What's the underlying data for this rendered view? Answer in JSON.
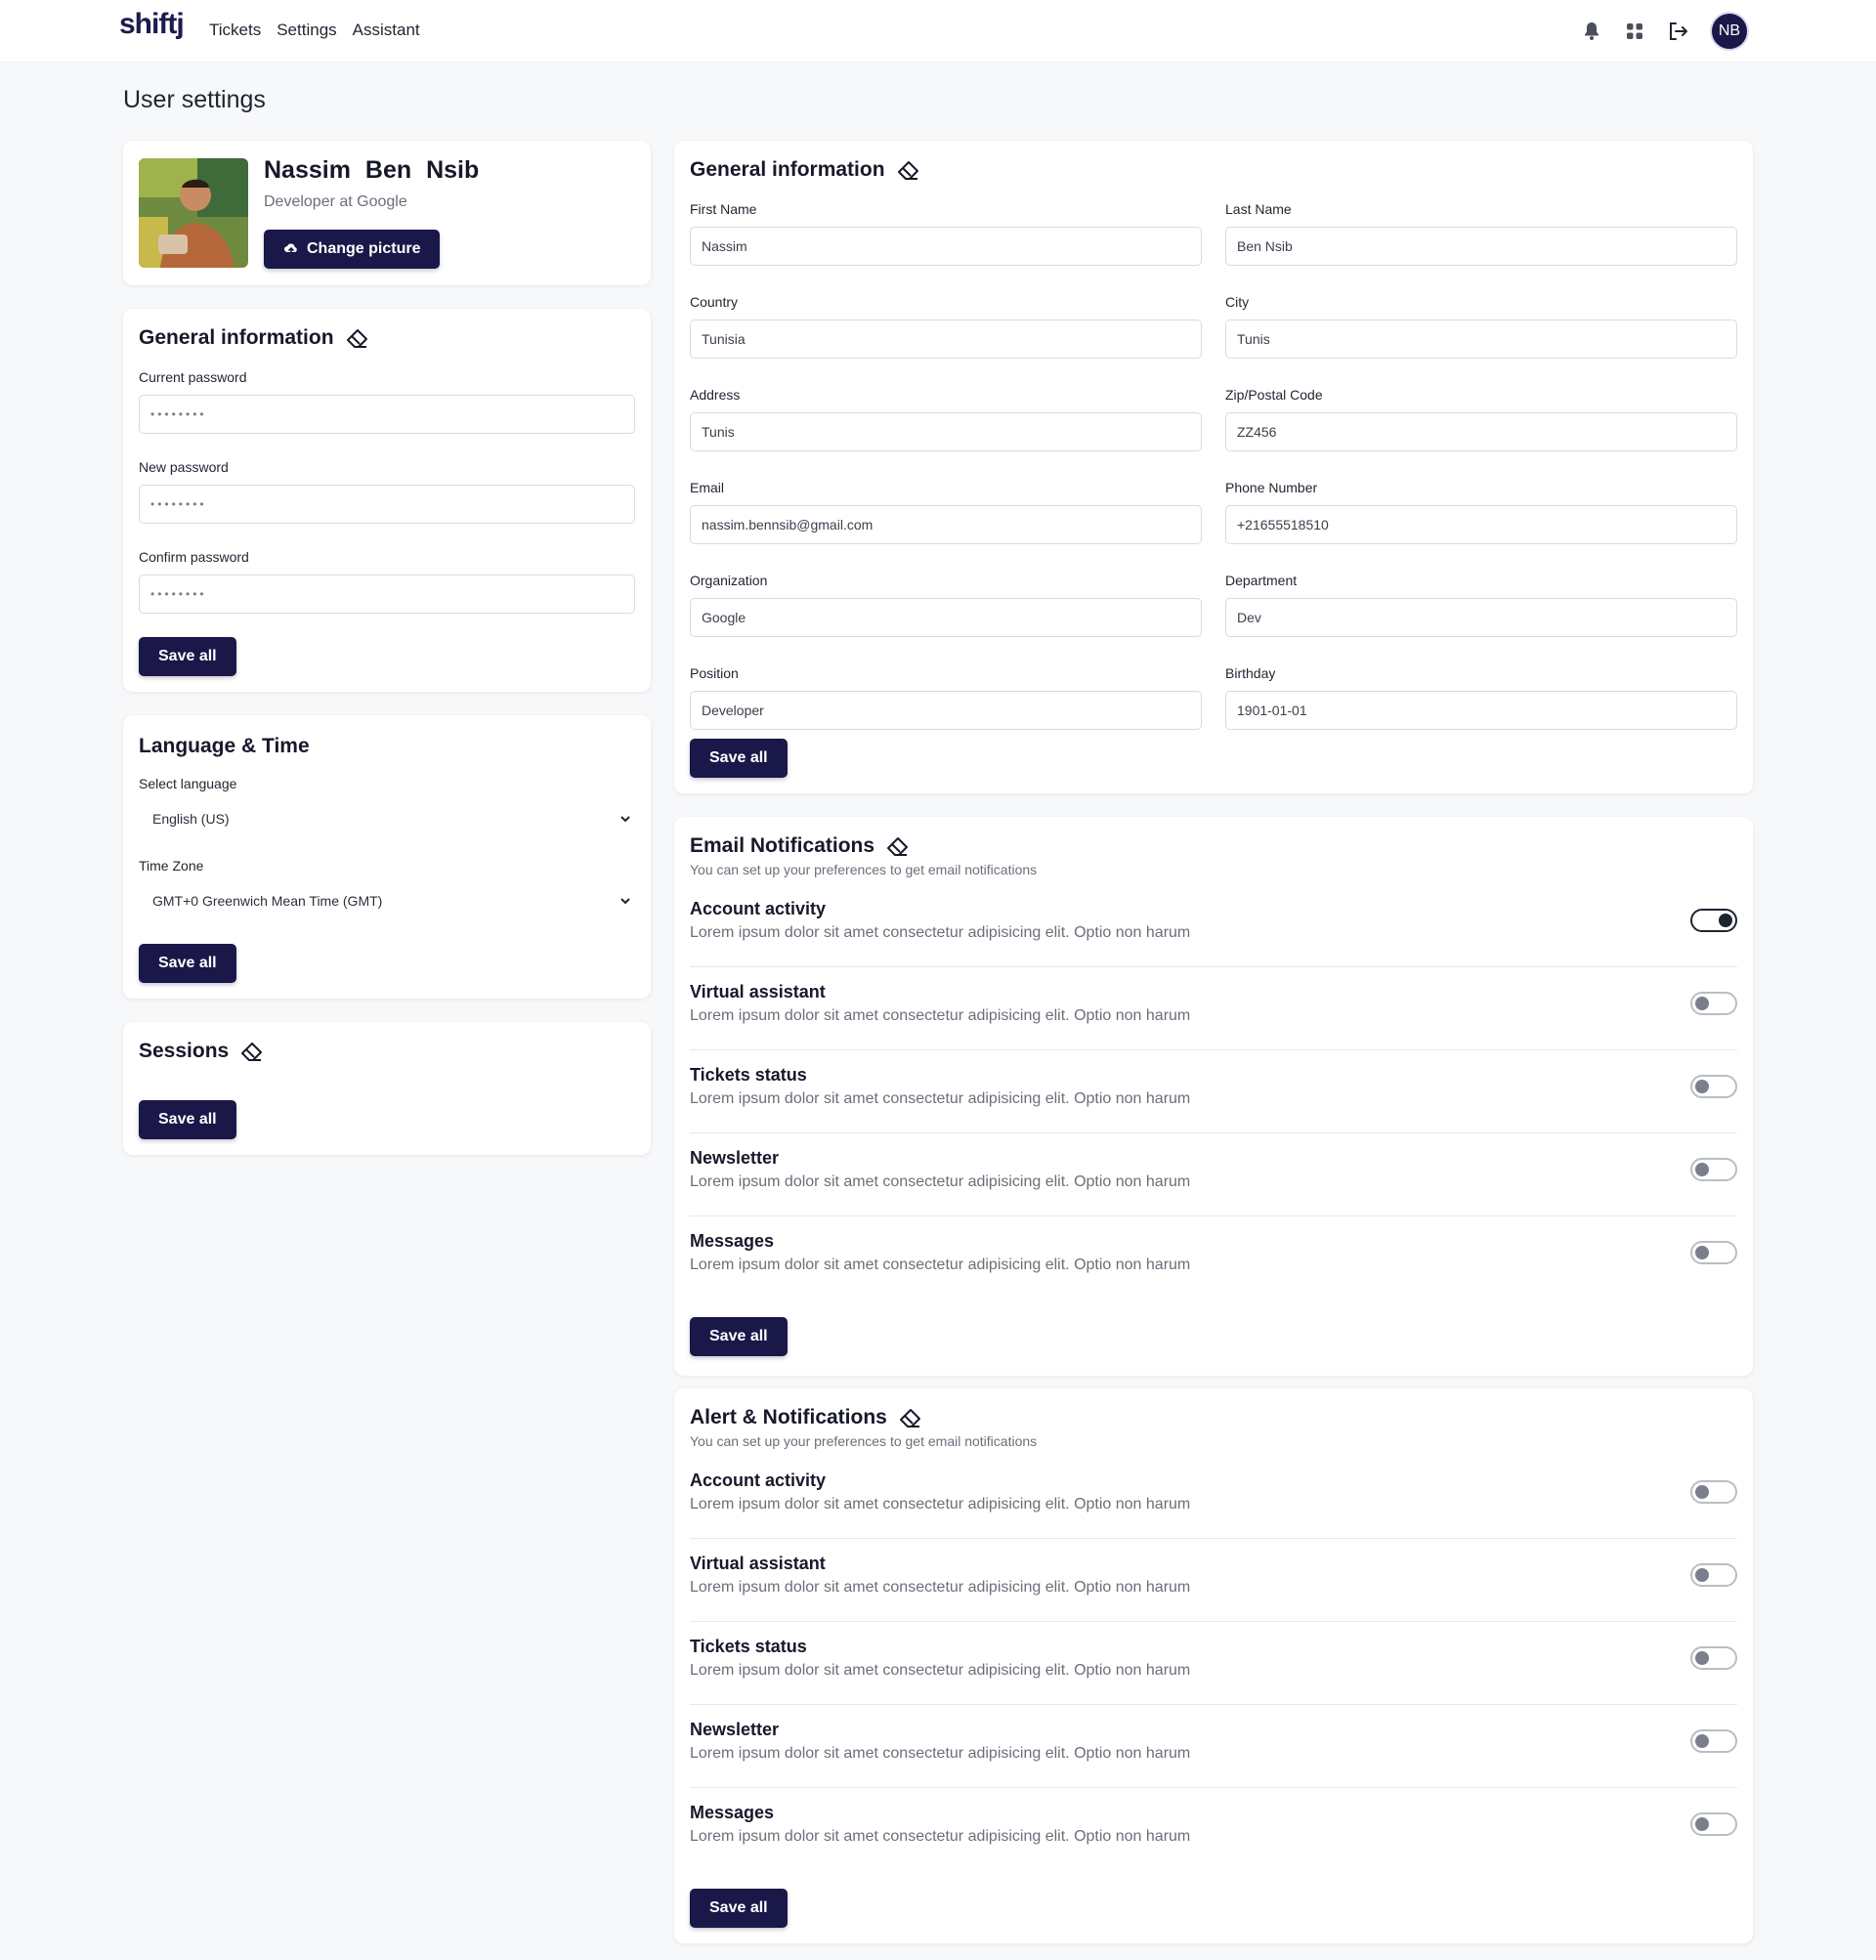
{
  "app": {
    "logo_text": "shiftj",
    "nav": [
      "Tickets",
      "Settings",
      "Assistant"
    ],
    "avatar_initials": "NB"
  },
  "page": {
    "title": "User settings"
  },
  "profile": {
    "first_name": "Nassim",
    "last_name": "Ben Nsib",
    "role": "Developer at Google",
    "change_picture_label": "Change picture"
  },
  "password_card": {
    "title": "General information",
    "fields": [
      {
        "label": "Current password",
        "value": "••••••••"
      },
      {
        "label": "New password",
        "value": "••••••••"
      },
      {
        "label": "Confirm password",
        "value": "••••••••"
      }
    ],
    "save_label": "Save all"
  },
  "language_card": {
    "title": "Language & Time",
    "language_label": "Select language",
    "language_value": "English (US)",
    "timezone_label": "Time Zone",
    "timezone_value": "GMT+0 Greenwich Mean Time (GMT)",
    "save_label": "Save all"
  },
  "sessions_card": {
    "title": "Sessions",
    "save_label": "Save all"
  },
  "general_info": {
    "title": "General information",
    "fields": [
      {
        "label": "First Name",
        "value": "Nassim"
      },
      {
        "label": "Last Name",
        "value": "Ben Nsib"
      },
      {
        "label": "Country",
        "value": "Tunisia"
      },
      {
        "label": "City",
        "value": "Tunis"
      },
      {
        "label": "Address",
        "value": "Tunis"
      },
      {
        "label": "Zip/Postal Code",
        "value": "ZZ456"
      },
      {
        "label": "Email",
        "value": "nassim.bennsib@gmail.com"
      },
      {
        "label": "Phone Number",
        "value": "+21655518510"
      },
      {
        "label": "Organization",
        "value": "Google"
      },
      {
        "label": "Department",
        "value": "Dev"
      },
      {
        "label": "Position",
        "value": "Developer"
      },
      {
        "label": "Birthday",
        "value": "1901-01-01"
      }
    ],
    "save_label": "Save all"
  },
  "email_notifications": {
    "title": "Email Notifications",
    "subtitle": "You can set up your preferences to get email notifications",
    "items": [
      {
        "title": "Account activity",
        "desc": "Lorem ipsum dolor sit amet consectetur adipisicing elit. Optio non harum",
        "enabled": true
      },
      {
        "title": "Virtual assistant",
        "desc": "Lorem ipsum dolor sit amet consectetur adipisicing elit. Optio non harum",
        "enabled": false
      },
      {
        "title": "Tickets status",
        "desc": "Lorem ipsum dolor sit amet consectetur adipisicing elit. Optio non harum",
        "enabled": false
      },
      {
        "title": "Newsletter",
        "desc": "Lorem ipsum dolor sit amet consectetur adipisicing elit. Optio non harum",
        "enabled": false
      },
      {
        "title": "Messages",
        "desc": "Lorem ipsum dolor sit amet consectetur adipisicing elit. Optio non harum",
        "enabled": false
      }
    ],
    "save_label": "Save all"
  },
  "alert_notifications": {
    "title": "Alert & Notifications",
    "subtitle": "You can set up your preferences to get email notifications",
    "items": [
      {
        "title": "Account activity",
        "desc": "Lorem ipsum dolor sit amet consectetur adipisicing elit. Optio non harum",
        "enabled": false
      },
      {
        "title": "Virtual assistant",
        "desc": "Lorem ipsum dolor sit amet consectetur adipisicing elit. Optio non harum",
        "enabled": false
      },
      {
        "title": "Tickets status",
        "desc": "Lorem ipsum dolor sit amet consectetur adipisicing elit. Optio non harum",
        "enabled": false
      },
      {
        "title": "Newsletter",
        "desc": "Lorem ipsum dolor sit amet consectetur adipisicing elit. Optio non harum",
        "enabled": false
      },
      {
        "title": "Messages",
        "desc": "Lorem ipsum dolor sit amet consectetur adipisicing elit. Optio non harum",
        "enabled": false
      }
    ],
    "save_label": "Save all"
  },
  "icons": {
    "bell": "bell-icon",
    "apps": "grid-icon",
    "logout": "logout-icon",
    "eraser": "eraser-icon",
    "upload": "upload-cloud-icon",
    "chevron": "chevron-down-icon"
  },
  "colors": {
    "primary": "#1a1848",
    "background": "#f7f8fa",
    "muted_text": "#6b6f7a"
  }
}
